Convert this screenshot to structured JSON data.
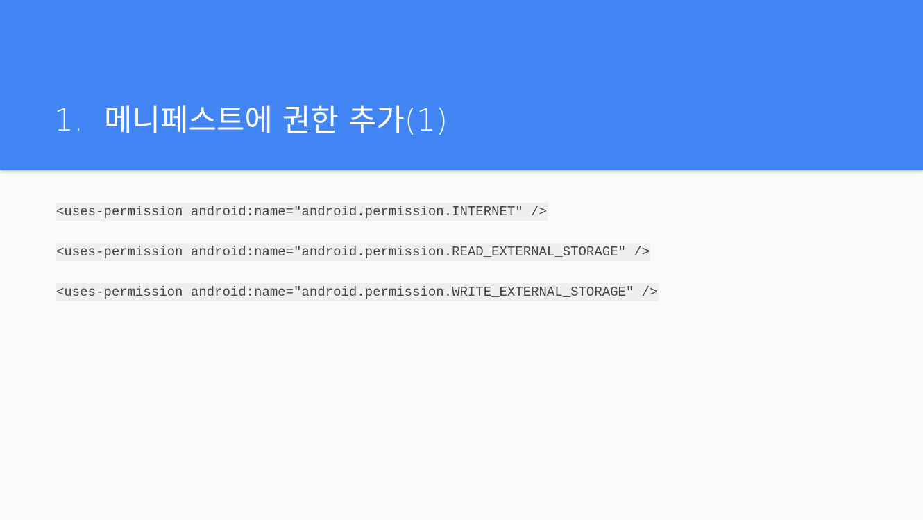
{
  "slide": {
    "title_number": "1.",
    "title_text": "메니페스트에 권한 추가(1)"
  },
  "code_lines": [
    "<uses-permission android:name=\"android.permission.INTERNET\" />",
    "<uses-permission android:name=\"android.permission.READ_EXTERNAL_STORAGE\" />",
    "<uses-permission android:name=\"android.permission.WRITE_EXTERNAL_STORAGE\" />"
  ],
  "colors": {
    "header_background": "#4285f4",
    "page_background": "#fafafa",
    "code_background": "#efefef",
    "code_text": "#444444"
  }
}
